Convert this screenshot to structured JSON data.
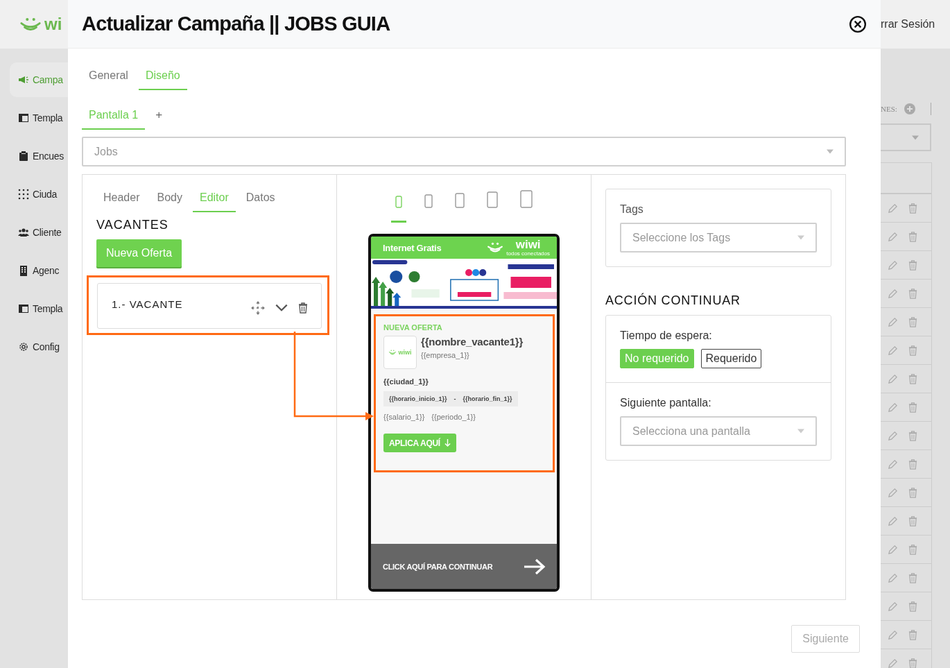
{
  "app": {
    "logo": "wi",
    "logout": "rrar Sesión"
  },
  "sidebar": {
    "items": [
      {
        "label": "Campa",
        "selected": true
      },
      {
        "label": "Templa",
        "selected": false
      },
      {
        "label": "Encues",
        "selected": false
      },
      {
        "label": "Ciuda",
        "selected": false
      },
      {
        "label": "Cliente",
        "selected": false
      },
      {
        "label": "Agenc",
        "selected": false
      },
      {
        "label": "Templa",
        "selected": false
      },
      {
        "label": "Config",
        "selected": false
      }
    ]
  },
  "background_list": {
    "label": "NES:",
    "rows": [
      {
        "kind": "actions"
      },
      {
        "kind": "actions"
      },
      {
        "kind": "actions"
      },
      {
        "kind": "actions"
      },
      {
        "kind": "actions"
      },
      {
        "kind": "actions"
      },
      {
        "kind": "actions"
      },
      {
        "kind": "actions"
      },
      {
        "kind": "actions"
      },
      {
        "kind": "actions"
      },
      {
        "kind": "actions"
      },
      {
        "kind": "actions"
      },
      {
        "kind": "actions"
      },
      {
        "kind": "actions"
      },
      {
        "kind": "actions"
      },
      {
        "kind": "actions"
      },
      {
        "kind": "actions"
      }
    ]
  },
  "modal": {
    "title": "Actualizar Campaña || JOBS GUIA",
    "tabs": [
      {
        "label": "General",
        "selected": false
      },
      {
        "label": "Diseño",
        "selected": true
      }
    ],
    "screens": [
      {
        "label": "Pantalla 1",
        "selected": true
      }
    ],
    "add_screen": "+",
    "template_select": {
      "value": "Jobs"
    },
    "editor": {
      "tabs": [
        {
          "label": "Header",
          "selected": false
        },
        {
          "label": "Body",
          "selected": false
        },
        {
          "label": "Editor",
          "selected": true
        },
        {
          "label": "Datos",
          "selected": false
        }
      ],
      "section_title": "VACANTES",
      "new_button": "Nueva Oferta",
      "vacancies": [
        {
          "label": "1.- VACANTE",
          "highlighted": true
        }
      ]
    },
    "preview": {
      "devices": [
        {
          "selected": true
        },
        {
          "selected": false
        },
        {
          "selected": false
        },
        {
          "selected": false
        },
        {
          "selected": false
        }
      ],
      "phone": {
        "header_title": "Internet Gratis",
        "brand": "wiwi",
        "tagline": "todos conectados",
        "card": {
          "highlighted": true,
          "eyebrow": "NUEVA OFERTA",
          "logo_text": "wiwi",
          "title": "{{nombre_vacante1}}",
          "company": "{{empresa_1}}",
          "city": "{{ciudad_1}}",
          "schedule_start": "{{horario_inicio_1}}",
          "schedule_separator": "-",
          "schedule_end": "{{horario_fin_1}}",
          "salary": "{{salario_1}}",
          "period": "{{periodo_1}}",
          "apply_button": "APLICA AQUÍ"
        },
        "footer": "CLICK AQUÍ PARA CONTINUAR"
      }
    },
    "settings": {
      "tags_label": "Tags",
      "tags_placeholder": "Seleccione los Tags",
      "action_title": "ACCIÓN CONTINUAR",
      "wait_label": "Tiempo de espera:",
      "wait_options": [
        {
          "label": "No requerido",
          "selected": true
        },
        {
          "label": "Requerido",
          "selected": false
        }
      ],
      "next_label": "Siguiente pantalla:",
      "next_placeholder": "Selecciona una pantalla"
    },
    "next_button": {
      "label": "Siguiente",
      "disabled": true
    }
  }
}
